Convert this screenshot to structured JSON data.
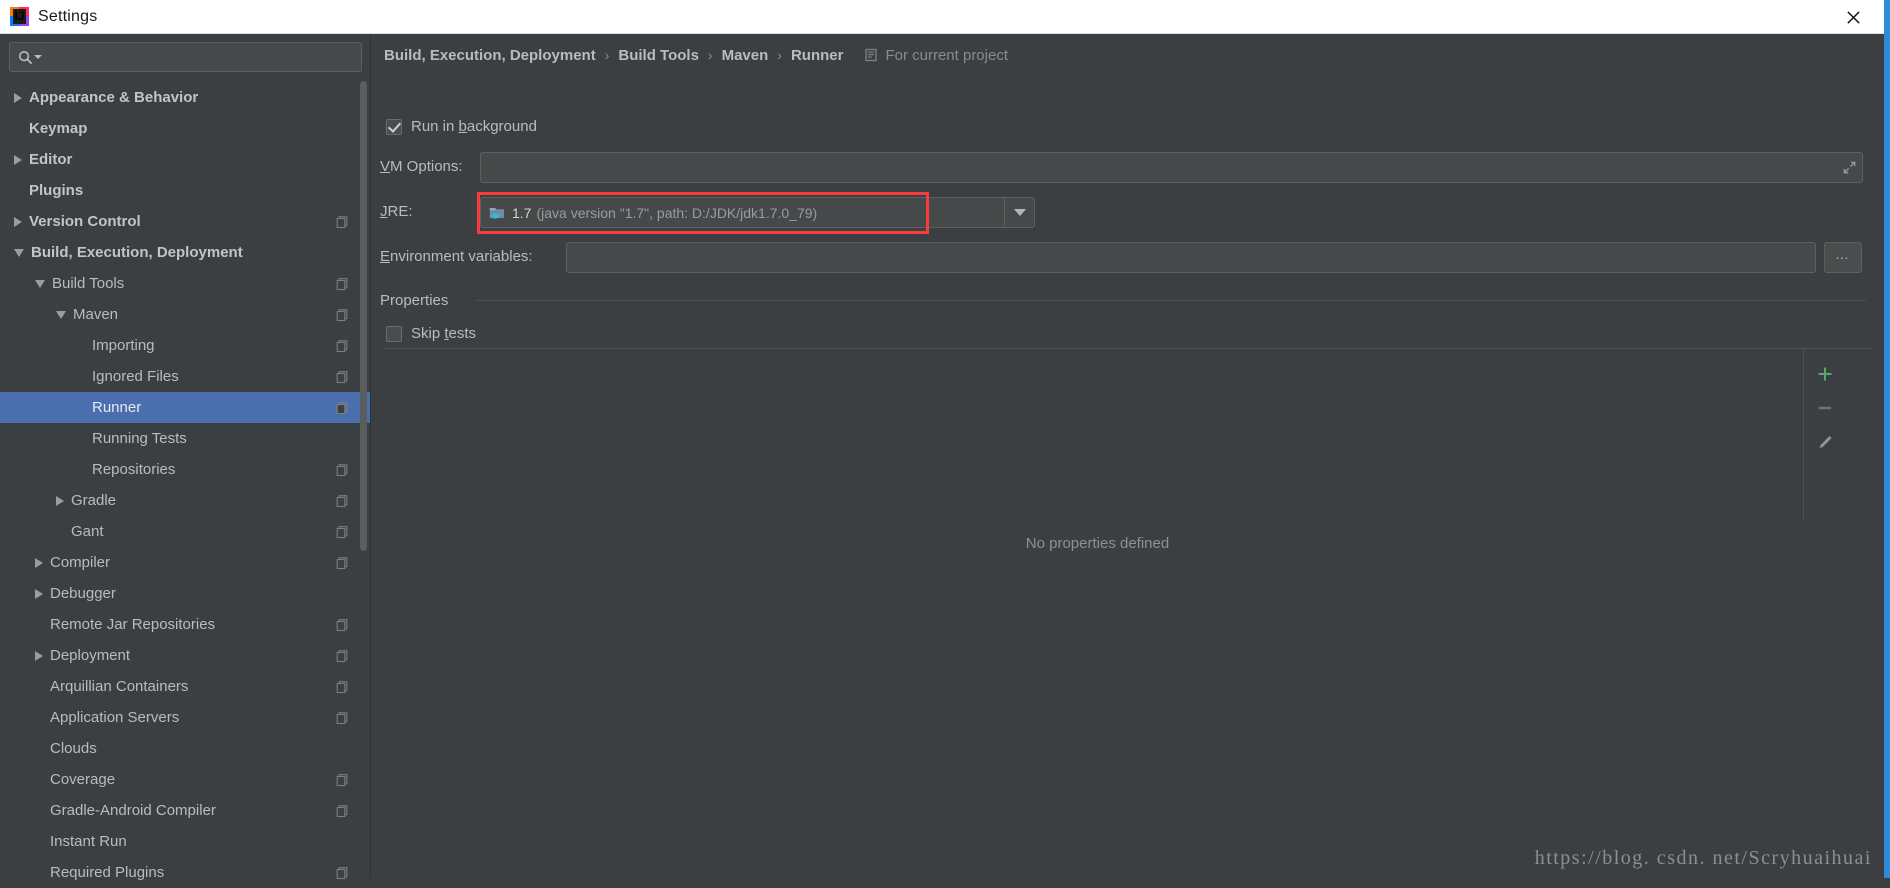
{
  "window": {
    "title": "Settings",
    "app_icon": "intellij-idea-logo",
    "close_icon": "close-icon"
  },
  "sidebar": {
    "search": {
      "placeholder": "",
      "value": "",
      "icon": "search-icon"
    },
    "items": [
      {
        "label": "Appearance & Behavior",
        "indent": 0,
        "twisty": "closed",
        "bold": true,
        "badge": false,
        "selected": false
      },
      {
        "label": "Keymap",
        "indent": 0,
        "twisty": "none",
        "bold": true,
        "badge": false,
        "selected": false
      },
      {
        "label": "Editor",
        "indent": 0,
        "twisty": "closed",
        "bold": true,
        "badge": false,
        "selected": false
      },
      {
        "label": "Plugins",
        "indent": 0,
        "twisty": "none",
        "bold": true,
        "badge": false,
        "selected": false
      },
      {
        "label": "Version Control",
        "indent": 0,
        "twisty": "closed",
        "bold": true,
        "badge": true,
        "selected": false
      },
      {
        "label": "Build, Execution, Deployment",
        "indent": 0,
        "twisty": "open",
        "bold": true,
        "badge": false,
        "selected": false
      },
      {
        "label": "Build Tools",
        "indent": 1,
        "twisty": "open",
        "bold": false,
        "badge": true,
        "selected": false
      },
      {
        "label": "Maven",
        "indent": 2,
        "twisty": "open",
        "bold": false,
        "badge": true,
        "selected": false
      },
      {
        "label": "Importing",
        "indent": 3,
        "twisty": "none",
        "bold": false,
        "badge": true,
        "selected": false
      },
      {
        "label": "Ignored Files",
        "indent": 3,
        "twisty": "none",
        "bold": false,
        "badge": true,
        "selected": false
      },
      {
        "label": "Runner",
        "indent": 3,
        "twisty": "none",
        "bold": false,
        "badge": true,
        "selected": true
      },
      {
        "label": "Running Tests",
        "indent": 3,
        "twisty": "none",
        "bold": false,
        "badge": false,
        "selected": false
      },
      {
        "label": "Repositories",
        "indent": 3,
        "twisty": "none",
        "bold": false,
        "badge": true,
        "selected": false
      },
      {
        "label": "Gradle",
        "indent": 2,
        "twisty": "closed",
        "bold": false,
        "badge": true,
        "selected": false
      },
      {
        "label": "Gant",
        "indent": 2,
        "twisty": "none",
        "bold": false,
        "badge": true,
        "selected": false
      },
      {
        "label": "Compiler",
        "indent": 1,
        "twisty": "closed",
        "bold": false,
        "badge": true,
        "selected": false
      },
      {
        "label": "Debugger",
        "indent": 1,
        "twisty": "closed",
        "bold": false,
        "badge": false,
        "selected": false
      },
      {
        "label": "Remote Jar Repositories",
        "indent": 1,
        "twisty": "none",
        "bold": false,
        "badge": true,
        "selected": false
      },
      {
        "label": "Deployment",
        "indent": 1,
        "twisty": "closed",
        "bold": false,
        "badge": true,
        "selected": false
      },
      {
        "label": "Arquillian Containers",
        "indent": 1,
        "twisty": "none",
        "bold": false,
        "badge": true,
        "selected": false
      },
      {
        "label": "Application Servers",
        "indent": 1,
        "twisty": "none",
        "bold": false,
        "badge": true,
        "selected": false
      },
      {
        "label": "Clouds",
        "indent": 1,
        "twisty": "none",
        "bold": false,
        "badge": false,
        "selected": false
      },
      {
        "label": "Coverage",
        "indent": 1,
        "twisty": "none",
        "bold": false,
        "badge": true,
        "selected": false
      },
      {
        "label": "Gradle-Android Compiler",
        "indent": 1,
        "twisty": "none",
        "bold": false,
        "badge": true,
        "selected": false
      },
      {
        "label": "Instant Run",
        "indent": 1,
        "twisty": "none",
        "bold": false,
        "badge": false,
        "selected": false
      },
      {
        "label": "Required Plugins",
        "indent": 1,
        "twisty": "none",
        "bold": false,
        "badge": true,
        "selected": false
      }
    ]
  },
  "panel": {
    "breadcrumb": {
      "parts": [
        "Build, Execution, Deployment",
        "Build Tools",
        "Maven",
        "Runner"
      ],
      "separator": "›",
      "scope_label": "For current project",
      "scope_icon": "project-scope-icon"
    },
    "run_in_background": {
      "label": "Run in background",
      "checked": true,
      "mnemonic": "b"
    },
    "vm_options": {
      "label": "VM Options:",
      "value": "",
      "expand_icon": "expand-arrows-icon"
    },
    "jre": {
      "label": "JRE:",
      "icon": "jdk-folder-icon",
      "value_main": "1.7",
      "value_detail": "(java version \"1.7\", path: D:/JDK/jdk1.7.0_79)",
      "dropdown_icon": "chevron-down-icon",
      "highlight_color": "#fb3b3b"
    },
    "environment_variables": {
      "label": "Environment variables:",
      "value": "",
      "browse_label": "…"
    },
    "properties": {
      "section_title": "Properties",
      "skip_tests": {
        "label": "Skip tests",
        "checked": false
      },
      "empty_text": "No properties defined",
      "toolbar": [
        {
          "name": "add-property-button",
          "icon": "plus-icon",
          "color": "#59a869"
        },
        {
          "name": "remove-property-button",
          "icon": "minus-icon",
          "color": "#6e7171"
        },
        {
          "name": "edit-property-button",
          "icon": "pencil-icon",
          "color": "#9aa0a6"
        }
      ]
    }
  },
  "watermark": {
    "text": "https://blog. csdn. net/Scryhuaihuai"
  },
  "colors": {
    "background": "#3c3f41",
    "titlebar": "#ffffff",
    "selection": "#4b6eaf",
    "field": "#45494a",
    "text": "#bbbbbb",
    "accent_scrollbar": "#2f8bd8"
  }
}
